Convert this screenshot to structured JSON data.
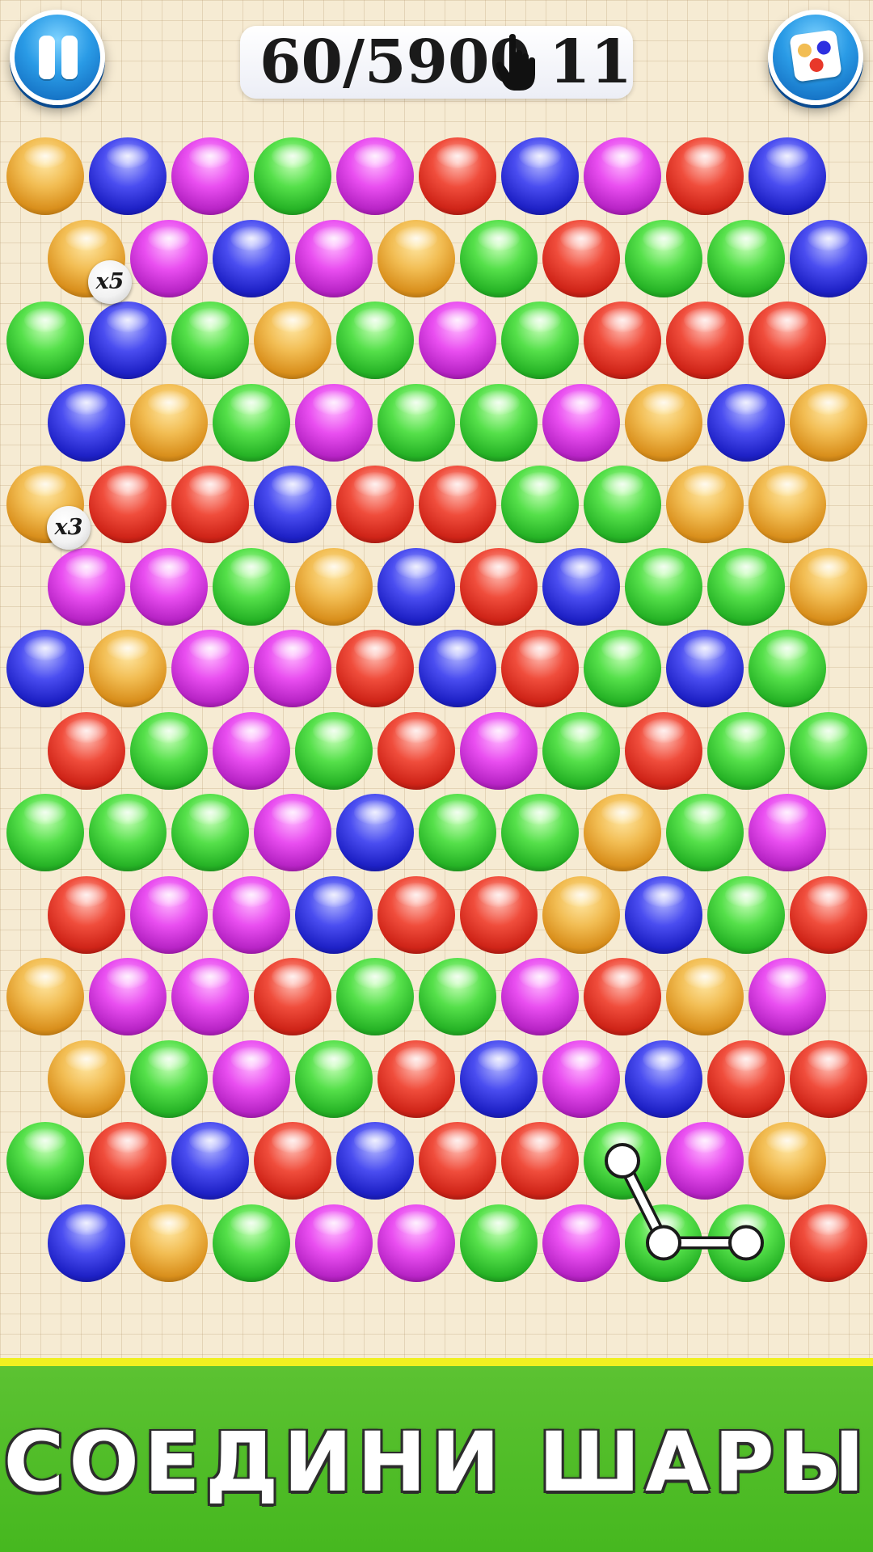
{
  "hud": {
    "score_text": "60/5900",
    "moves_text": "11"
  },
  "icons": {
    "pause": "pause-icon",
    "hand": "hand-pointer-icon",
    "palette": "color-palette-icon"
  },
  "colors": {
    "orange": "#f2bd53",
    "blue": "#2d30e0",
    "magenta": "#d93ce0",
    "green": "#3ed83a",
    "red": "#e8382a",
    "banner_green": "#4fbc26",
    "banner_stripe": "#f0f020"
  },
  "board": {
    "rows": [
      [
        "orange",
        "blue",
        "magenta",
        "green",
        "magenta",
        "red",
        "blue",
        "magenta",
        "red",
        "blue"
      ],
      [
        "orange",
        "magenta",
        "blue",
        "magenta",
        "orange",
        "green",
        "red",
        "green",
        "green",
        "blue"
      ],
      [
        "green",
        "blue",
        "green",
        "orange",
        "green",
        "magenta",
        "green",
        "red",
        "red",
        "red"
      ],
      [
        "blue",
        "orange",
        "green",
        "magenta",
        "green",
        "green",
        "magenta",
        "orange",
        "blue",
        "orange"
      ],
      [
        "orange",
        "red",
        "red",
        "blue",
        "red",
        "red",
        "green",
        "green",
        "orange",
        "orange"
      ],
      [
        "magenta",
        "magenta",
        "green",
        "orange",
        "blue",
        "red",
        "blue",
        "green",
        "green",
        "orange"
      ],
      [
        "blue",
        "orange",
        "magenta",
        "magenta",
        "red",
        "blue",
        "red",
        "green",
        "blue",
        "green"
      ],
      [
        "red",
        "green",
        "magenta",
        "green",
        "red",
        "magenta",
        "green",
        "red",
        "green",
        "green"
      ],
      [
        "green",
        "green",
        "green",
        "magenta",
        "blue",
        "green",
        "green",
        "orange",
        "green",
        "magenta"
      ],
      [
        "red",
        "magenta",
        "magenta",
        "blue",
        "red",
        "red",
        "orange",
        "blue",
        "green",
        "red"
      ],
      [
        "orange",
        "magenta",
        "magenta",
        "red",
        "green",
        "green",
        "magenta",
        "red",
        "orange",
        "magenta"
      ],
      [
        "orange",
        "green",
        "magenta",
        "green",
        "red",
        "blue",
        "magenta",
        "blue",
        "red",
        "red"
      ],
      [
        "green",
        "red",
        "blue",
        "red",
        "blue",
        "red",
        "red",
        "green",
        "magenta",
        "orange"
      ],
      [
        "blue",
        "orange",
        "green",
        "magenta",
        "magenta",
        "green",
        "magenta",
        "green",
        "green",
        "red"
      ]
    ],
    "multipliers": [
      {
        "row": 1,
        "col": 0,
        "label": "x5"
      },
      {
        "row": 4,
        "col": 0,
        "label": "x3"
      }
    ],
    "selected_path": [
      {
        "row": 12,
        "col": 7
      },
      {
        "row": 13,
        "col": 7
      },
      {
        "row": 13,
        "col": 8
      }
    ]
  },
  "banner": {
    "title": "СОЕДИНИ ШАРЫ"
  }
}
